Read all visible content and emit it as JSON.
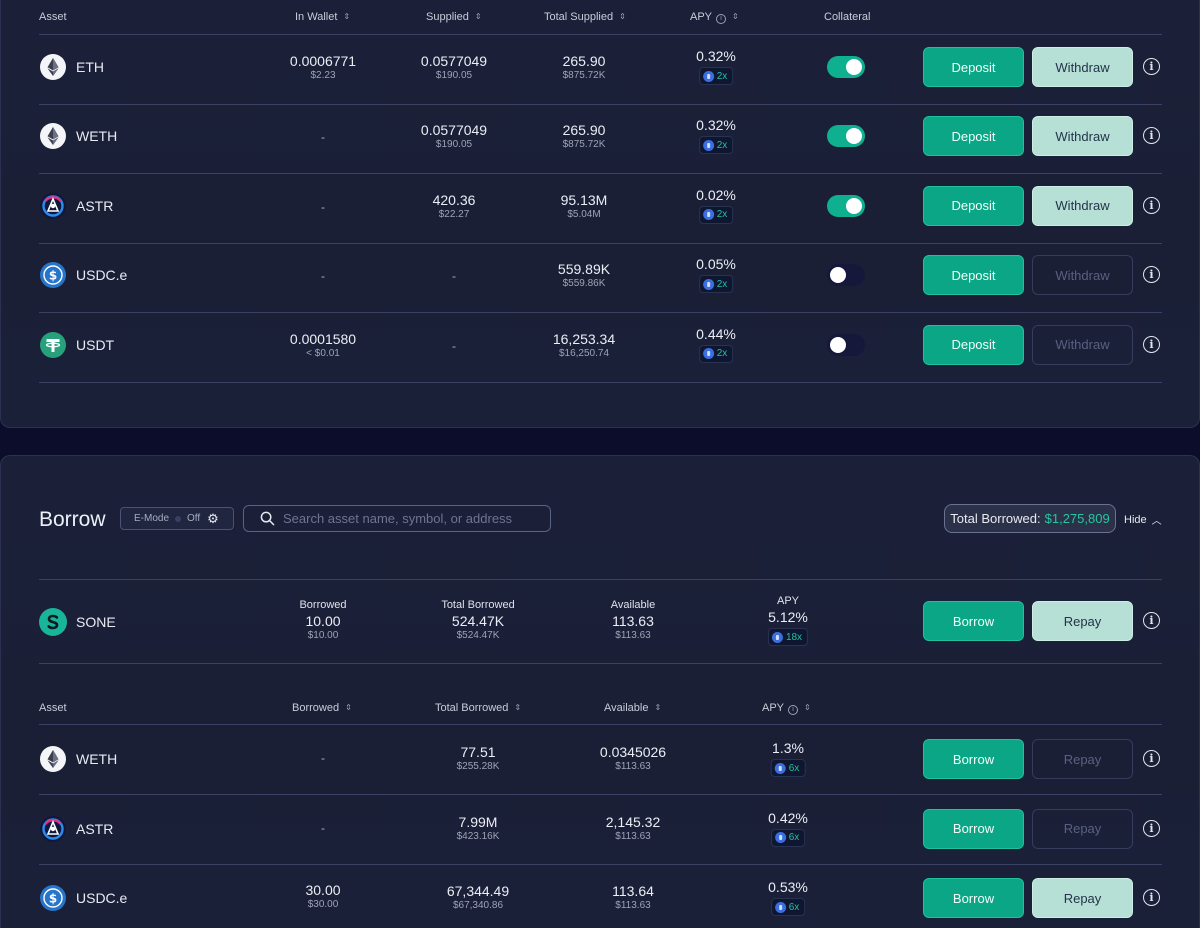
{
  "supply": {
    "headers": {
      "asset": "Asset",
      "in_wallet": "In Wallet",
      "supplied": "Supplied",
      "total_supplied": "Total Supplied",
      "apy": "APY",
      "collateral": "Collateral"
    },
    "rows": [
      {
        "symbol": "ETH",
        "icon": "eth-icon",
        "wallet": "0.0006771",
        "wallet_usd": "$2.23",
        "supplied": "0.0577049",
        "supplied_usd": "$190.05",
        "total": "265.90",
        "total_usd": "$875.72K",
        "apy": "0.32%",
        "mult": "2x",
        "collateral": true,
        "deposit": "Deposit",
        "withdraw": "Withdraw",
        "withdraw_enabled": true
      },
      {
        "symbol": "WETH",
        "icon": "eth-icon",
        "wallet": "-",
        "wallet_usd": "",
        "supplied": "0.0577049",
        "supplied_usd": "$190.05",
        "total": "265.90",
        "total_usd": "$875.72K",
        "apy": "0.32%",
        "mult": "2x",
        "collateral": true,
        "deposit": "Deposit",
        "withdraw": "Withdraw",
        "withdraw_enabled": true
      },
      {
        "symbol": "ASTR",
        "icon": "astr-icon",
        "wallet": "-",
        "wallet_usd": "",
        "supplied": "420.36",
        "supplied_usd": "$22.27",
        "total": "95.13M",
        "total_usd": "$5.04M",
        "apy": "0.02%",
        "mult": "2x",
        "collateral": true,
        "deposit": "Deposit",
        "withdraw": "Withdraw",
        "withdraw_enabled": true
      },
      {
        "symbol": "USDC.e",
        "icon": "usdc-icon",
        "wallet": "-",
        "wallet_usd": "",
        "supplied": "-",
        "supplied_usd": "",
        "total": "559.89K",
        "total_usd": "$559.86K",
        "apy": "0.05%",
        "mult": "2x",
        "collateral": false,
        "deposit": "Deposit",
        "withdraw": "Withdraw",
        "withdraw_enabled": false
      },
      {
        "symbol": "USDT",
        "icon": "usdt-icon",
        "wallet": "0.0001580",
        "wallet_usd": "< $0.01",
        "supplied": "-",
        "supplied_usd": "",
        "total": "16,253.34",
        "total_usd": "$16,250.74",
        "apy": "0.44%",
        "mult": "2x",
        "collateral": false,
        "deposit": "Deposit",
        "withdraw": "Withdraw",
        "withdraw_enabled": false
      }
    ]
  },
  "borrow": {
    "title": "Borrow",
    "emode_label": "E-Mode",
    "emode_state": "Off",
    "search_placeholder": "Search asset name, symbol, or address",
    "total_label": "Total Borrowed:",
    "total_value": "$1,275,809",
    "hide_label": "Hide",
    "featured": {
      "symbol": "SONE",
      "icon": "sone-icon",
      "borrowed_label": "Borrowed",
      "borrowed": "10.00",
      "borrowed_usd": "$10.00",
      "total_label": "Total Borrowed",
      "total": "524.47K",
      "total_usd": "$524.47K",
      "available_label": "Available",
      "available": "113.63",
      "available_usd": "$113.63",
      "apy_label": "APY",
      "apy": "5.12%",
      "mult": "18x",
      "borrow": "Borrow",
      "repay": "Repay"
    },
    "headers": {
      "asset": "Asset",
      "borrowed": "Borrowed",
      "total_borrowed": "Total Borrowed",
      "available": "Available",
      "apy": "APY"
    },
    "rows": [
      {
        "symbol": "WETH",
        "icon": "eth-icon",
        "borrowed": "-",
        "borrowed_usd": "",
        "total": "77.51",
        "total_usd": "$255.28K",
        "available": "0.0345026",
        "available_usd": "$113.63",
        "apy": "1.3%",
        "mult": "6x",
        "borrow": "Borrow",
        "repay": "Repay",
        "repay_enabled": false
      },
      {
        "symbol": "ASTR",
        "icon": "astr-icon",
        "borrowed": "-",
        "borrowed_usd": "",
        "total": "7.99M",
        "total_usd": "$423.16K",
        "available": "2,145.32",
        "available_usd": "$113.63",
        "apy": "0.42%",
        "mult": "6x",
        "borrow": "Borrow",
        "repay": "Repay",
        "repay_enabled": false
      },
      {
        "symbol": "USDC.e",
        "icon": "usdc-icon",
        "borrowed": "30.00",
        "borrowed_usd": "$30.00",
        "total": "67,344.49",
        "total_usd": "$67,340.86",
        "available": "113.64",
        "available_usd": "$113.63",
        "apy": "0.53%",
        "mult": "6x",
        "borrow": "Borrow",
        "repay": "Repay",
        "repay_enabled": true
      }
    ]
  },
  "colors": {
    "primary_button": "#0aa685",
    "secondary_button": "#b6dfd5",
    "accent_text": "#25c6a2",
    "panel_bg": "#1b2038",
    "page_bg": "#0b0d2a"
  }
}
